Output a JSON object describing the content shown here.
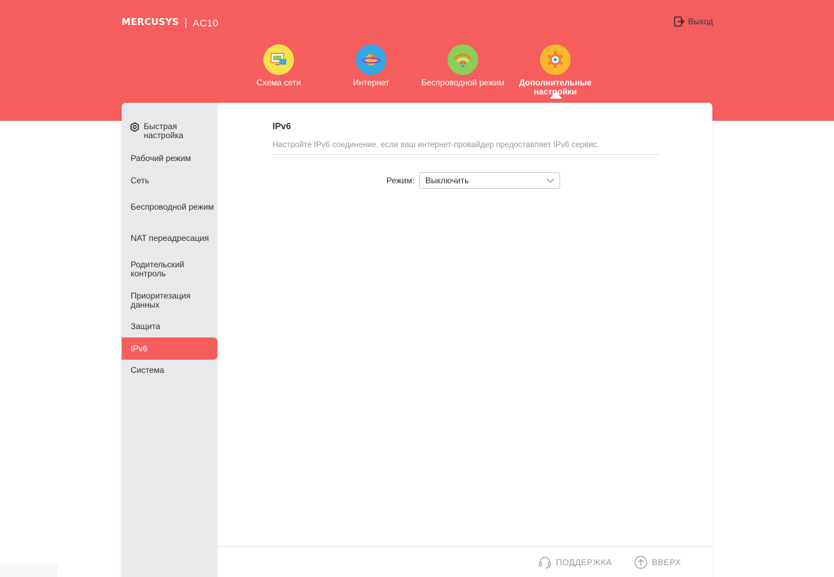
{
  "header": {
    "brand": "MERCUSYS",
    "separator": "|",
    "model": "AC10",
    "logout_label": "Выход"
  },
  "topnav": [
    {
      "label": "Схема сети",
      "icon": "network-map-icon",
      "color": "#f7e24a"
    },
    {
      "label": "Интернет",
      "icon": "globe-icon",
      "color": "#35a7e8"
    },
    {
      "label": "Беспроводной режим",
      "icon": "wifi-icon",
      "color": "#8bcf5a"
    },
    {
      "label": "Дополнительные настройки",
      "icon": "gear-icon",
      "color": "#f7b82b",
      "active": true
    }
  ],
  "sidebar": {
    "items": [
      {
        "label": "Быстрая настройка",
        "icon": "quick-setup-icon"
      },
      {
        "label": "Рабочий режим"
      },
      {
        "label": "Сеть"
      },
      {
        "label": "Беспроводной режим"
      },
      {
        "label": "NAT переадресация"
      },
      {
        "label": "Родительский контроль"
      },
      {
        "label": "Приоритезация данных"
      },
      {
        "label": "Защита"
      },
      {
        "label": "IPv6",
        "active": true
      },
      {
        "label": "Система"
      }
    ]
  },
  "main": {
    "title": "IPv6",
    "description": "Настройте IPv6 соединение, если ваш интернет-провайдер предоставляет IPv6 сервис.",
    "mode_label": "Режим:",
    "mode_value": "Выключить"
  },
  "footer": {
    "support_label": "ПОДДЕРЖКА",
    "top_label": "ВВЕРХ"
  },
  "colors": {
    "accent": "#f65e5e",
    "sidebar_bg": "#e9e9ea"
  }
}
